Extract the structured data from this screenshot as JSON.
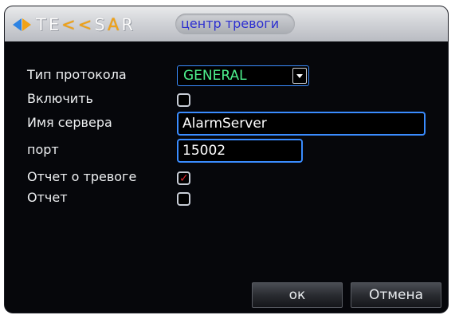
{
  "window": {
    "brand": {
      "prefix": "T",
      "mid": "E",
      "arrows": "<<",
      "s": "S",
      "a": "A",
      "r": "R"
    },
    "tab_title": "центр тревоги"
  },
  "form": {
    "protocol_label": "Тип протокола",
    "protocol_value": "GENERAL",
    "enable_label": "Включить",
    "enable_checked": false,
    "server_name_label": "Имя сервера",
    "server_name_value": "AlarmServer",
    "port_label": "порт",
    "port_value": "15002",
    "alarm_report_label": "Отчет о тревоге",
    "alarm_report_checked": true,
    "report_label": "Отчет",
    "report_checked": false
  },
  "buttons": {
    "ok_label": "ок",
    "cancel_label": "Отмена"
  },
  "colors": {
    "accent_blue": "#3a8cff",
    "combo_text": "#4cf08c",
    "checkmark": "#e0252c",
    "tab_text": "#2d2fd0"
  }
}
